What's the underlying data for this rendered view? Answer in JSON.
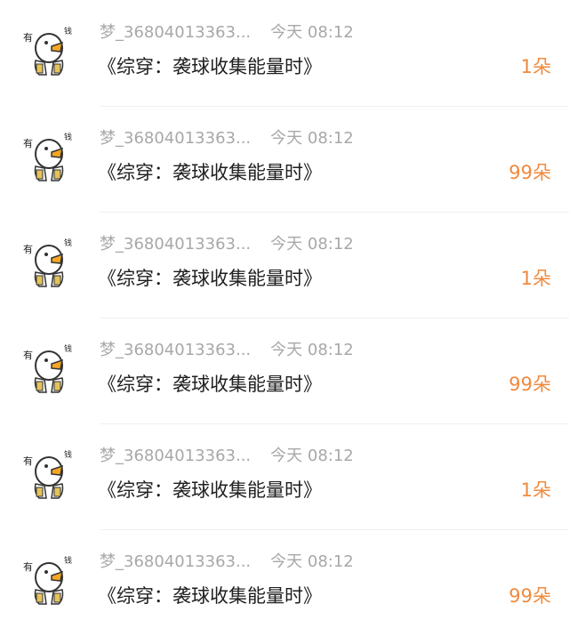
{
  "colors": {
    "meta_text": "#a8a8a8",
    "title_text": "#1e1e1e",
    "gift_accent": "#f08a3e",
    "divider": "#f0f0f0"
  },
  "avatar_icon": "duck-with-money-sticker-icon",
  "avatar_text": {
    "left": "有",
    "right": "钱"
  },
  "items": [
    {
      "username": "梦_36804013363...",
      "time": "今天 08:12",
      "title": "《综穿：袭球收集能量时》",
      "gift": "1朵"
    },
    {
      "username": "梦_36804013363...",
      "time": "今天 08:12",
      "title": "《综穿：袭球收集能量时》",
      "gift": "99朵"
    },
    {
      "username": "梦_36804013363...",
      "time": "今天 08:12",
      "title": "《综穿：袭球收集能量时》",
      "gift": "1朵"
    },
    {
      "username": "梦_36804013363...",
      "time": "今天 08:12",
      "title": "《综穿：袭球收集能量时》",
      "gift": "99朵"
    },
    {
      "username": "梦_36804013363...",
      "time": "今天 08:12",
      "title": "《综穿：袭球收集能量时》",
      "gift": "1朵"
    },
    {
      "username": "梦_36804013363...",
      "time": "今天 08:12",
      "title": "《综穿：袭球收集能量时》",
      "gift": "99朵"
    }
  ]
}
